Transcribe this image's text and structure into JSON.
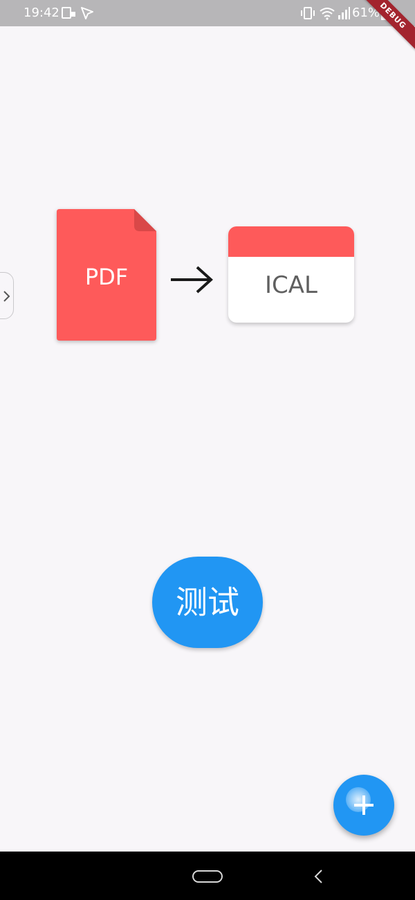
{
  "status_bar": {
    "time": "19:42",
    "battery": "61%",
    "icons": [
      "screen-record-icon",
      "send-icon",
      "vibrate-icon",
      "wifi-icon",
      "signal-icon",
      "battery-icon"
    ]
  },
  "debug_banner": {
    "label": "DEBUG",
    "color": "#a3242e"
  },
  "drawer_handle": {
    "icon": "chevron-right-icon"
  },
  "illustration": {
    "source_label": "PDF",
    "source_color": "#fe5a5a",
    "arrow_icon": "arrow-right-icon",
    "target_label": "ICAL",
    "target_header_color": "#fe5a5a"
  },
  "main": {
    "test_button_label": "测试"
  },
  "fab": {
    "icon": "plus-icon",
    "color": "#2196f3"
  },
  "nav_bar": {
    "icons": [
      "home-pill-icon",
      "back-icon"
    ]
  }
}
